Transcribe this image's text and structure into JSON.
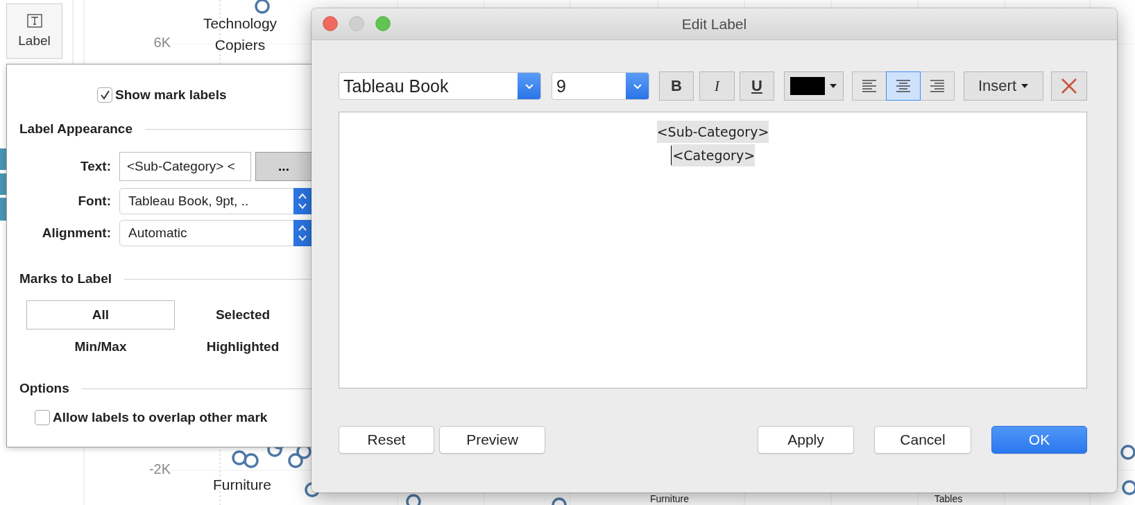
{
  "shelf_button": {
    "label": "Label"
  },
  "chart": {
    "y_ticks": [
      "6K",
      "-2K"
    ],
    "mark_labels": [
      {
        "lines": [
          "Technology",
          "Copiers"
        ]
      },
      {
        "lines": [
          "Furniture"
        ]
      },
      {
        "lines": [
          "Furniture"
        ]
      },
      {
        "lines": [
          "Tables"
        ]
      }
    ]
  },
  "label_panel": {
    "show_mark_labels": {
      "label": "Show mark labels",
      "checked": true
    },
    "appearance": {
      "title": "Label Appearance",
      "fields": [
        {
          "kind": "text",
          "label": "Text:",
          "value": "<Sub-Category> <",
          "button": "..."
        },
        {
          "kind": "select",
          "label": "Font:",
          "value": "Tableau Book, 9pt, .."
        },
        {
          "kind": "select",
          "label": "Alignment:",
          "value": "Automatic"
        }
      ]
    },
    "marks_to_label": {
      "title": "Marks to Label",
      "options": [
        {
          "label": "All",
          "selected": true
        },
        {
          "label": "Selected",
          "selected": false
        },
        {
          "label": "Min/Max",
          "selected": false
        },
        {
          "label": "Highlighted",
          "selected": false
        }
      ]
    },
    "options": {
      "title": "Options",
      "items": [
        {
          "label": "Allow labels to overlap other mark",
          "checked": false
        }
      ]
    }
  },
  "dialog": {
    "title": "Edit Label",
    "font": {
      "value": "Tableau Book"
    },
    "size": {
      "value": "9"
    },
    "styles": [
      {
        "kind": "bold",
        "label": "B",
        "on": false
      },
      {
        "kind": "italic",
        "label": "I",
        "on": false
      },
      {
        "kind": "underline",
        "label": "U",
        "on": false
      }
    ],
    "color_picker": {
      "color": "#000000"
    },
    "alignment": [
      {
        "kind": "left",
        "selected": false
      },
      {
        "kind": "center",
        "selected": true
      },
      {
        "kind": "right",
        "selected": false
      }
    ],
    "insert": {
      "label": "Insert"
    },
    "editor": {
      "lines": [
        "<Sub-Category>",
        "<Category>"
      ]
    },
    "left_buttons": [
      {
        "label": "Reset"
      },
      {
        "label": "Preview"
      }
    ],
    "right_buttons": [
      {
        "label": "Apply",
        "default": false
      },
      {
        "label": "Cancel",
        "default": false
      },
      {
        "label": "OK",
        "default": true
      }
    ]
  }
}
